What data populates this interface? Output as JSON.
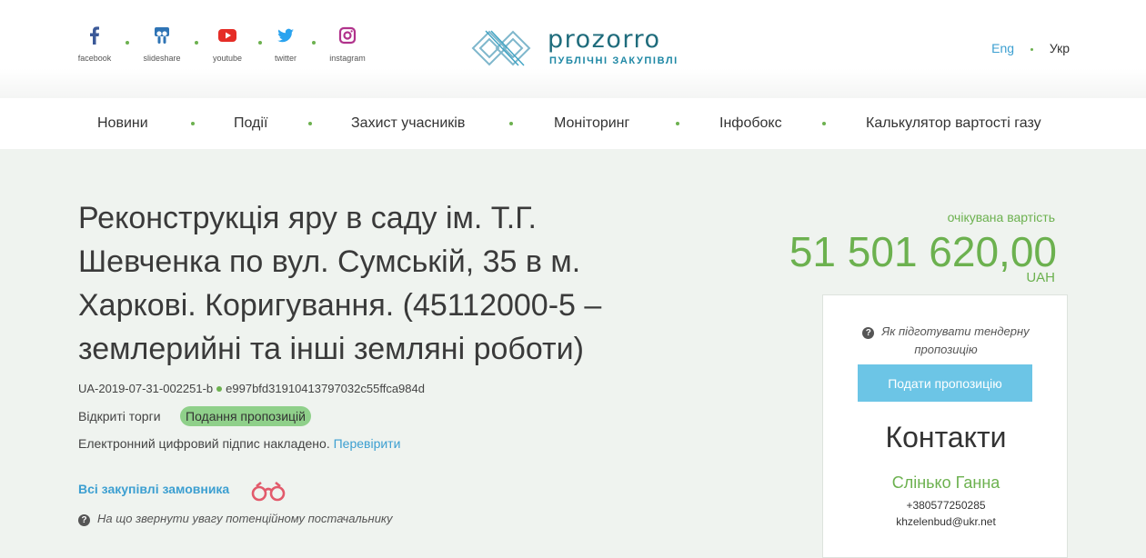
{
  "social": [
    {
      "label": "facebook",
      "icon": "facebook-icon",
      "color": "#3b5998"
    },
    {
      "label": "slideshare",
      "icon": "slideshare-icon",
      "color": "#2f74b5"
    },
    {
      "label": "youtube",
      "icon": "youtube-icon",
      "color": "#e52d27"
    },
    {
      "label": "twitter",
      "icon": "twitter-icon",
      "color": "#2aa3ef"
    },
    {
      "label": "instagram",
      "icon": "instagram-icon",
      "color": "#b1338c"
    }
  ],
  "logo": {
    "word": "prozorro",
    "subtitle": "ПУБЛІЧНІ ЗАКУПІВЛІ"
  },
  "lang": {
    "en": "Eng",
    "uk": "Укр"
  },
  "nav": [
    "Новини",
    "Події",
    "Захист учасників",
    "Моніторинг",
    "Інфобокс",
    "Калькулятор вартості газу"
  ],
  "tender": {
    "title": "Реконструкція яру в саду ім. Т.Г. Шевченка по вул. Сумській, 35 в м. Харкові. Коригування. (45112000-5 – землерийні та інші земляні роботи)",
    "id": "UA-2019-07-31-002251-b",
    "hash": "e997bfd31910413797032c55ffca984d",
    "procurement_type": "Відкриті торги",
    "status": "Подання пропозицій",
    "signature_text": "Електронний цифровий підпис накладено.",
    "verify_link": "Перевірити",
    "all_purchases_link": "Всі закупівлі замовника",
    "supplier_hint": "На що звернути увагу потенційному постачальнику"
  },
  "expected": {
    "label": "очікувана вартість",
    "value": "51 501 620,00",
    "currency": "UAH"
  },
  "panel": {
    "howto_line1": "Як підготувати тендерну",
    "howto_line2": "пропозицію",
    "submit_label": "Подати пропозицію",
    "contacts_title": "Контакти",
    "contact_name": "Слінько Ганна",
    "phone": "+380577250285",
    "email": "khzelenbud@ukr.net"
  },
  "colors": {
    "accent_green": "#6cb14f",
    "link_blue": "#3c9fd1",
    "button_blue": "#6cc5e6"
  }
}
